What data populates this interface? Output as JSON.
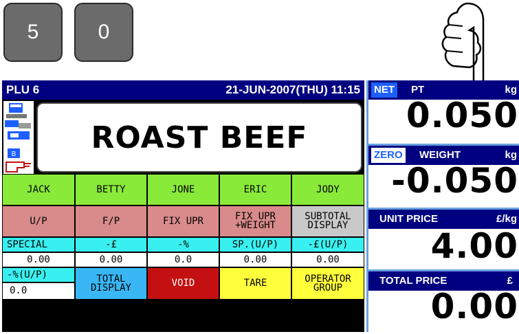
{
  "keypad": {
    "key1": "5",
    "key2": "0"
  },
  "header": {
    "plu": "PLU 6",
    "datetime": "21-JUN-2007(THU) 11:15"
  },
  "item": {
    "name": "ROAST BEEF"
  },
  "operators": [
    "JACK",
    "BETTY",
    "JONE",
    "ERIC",
    "JODY"
  ],
  "functions": [
    {
      "label": "U/P"
    },
    {
      "label": "F/P"
    },
    {
      "label": "FIX UPR"
    },
    {
      "label1": "FIX UPR",
      "label2": "+WEIGHT"
    },
    {
      "label1": "SUBTOTAL",
      "label2": "DISPLAY"
    }
  ],
  "discount_labels": [
    "SPECIAL",
    "-£",
    "-%",
    "SP.(U/P)",
    "-£(U/P)"
  ],
  "discount_values": [
    "0.00",
    "0.00",
    "0.0",
    "0.00",
    "0.00"
  ],
  "bottom": {
    "pct_label": "-%(U/P)",
    "pct_value": "0.0",
    "total_display_1": "TOTAL",
    "total_display_2": "DISPLAY",
    "void": "VOID",
    "tare": "TARE",
    "operator_group_1": "OPERATOR",
    "operator_group_2": "GROUP"
  },
  "right": {
    "net_badge": "NET",
    "pt_label": "PT",
    "pt_unit": "kg",
    "tare_value": "0.050",
    "zero_badge": "ZERO",
    "weight_label": "WEIGHT",
    "weight_unit": "kg",
    "weight_value": "-0.050",
    "unit_price_label": "UNIT PRICE",
    "unit_price_unit": "£/kg",
    "unit_price_value": "4.00",
    "total_price_label": "TOTAL PRICE",
    "total_price_unit": "£",
    "total_price_value": "0.00"
  },
  "colors": {
    "header_bg": "#000080",
    "operator_key": "#8aea3a",
    "price_key": "#d98b8b",
    "discount_label": "#39f0f0",
    "void_key": "#c41010",
    "tare_key": "#ffff3c",
    "total_display_key": "#39b7f5"
  },
  "icons": [
    "pointing-hand-icon",
    "scale-network-icon",
    "hand-icon"
  ]
}
